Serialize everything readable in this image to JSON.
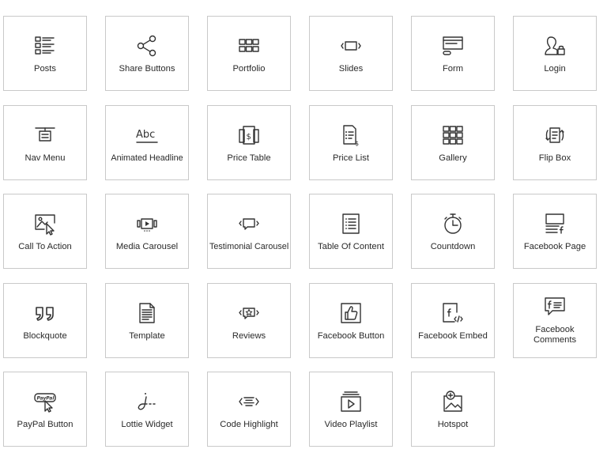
{
  "widgets": [
    {
      "label": "Posts",
      "icon": "posts-icon"
    },
    {
      "label": "Share Buttons",
      "icon": "share-icon"
    },
    {
      "label": "Portfolio",
      "icon": "portfolio-icon"
    },
    {
      "label": "Slides",
      "icon": "slides-icon"
    },
    {
      "label": "Form",
      "icon": "form-icon"
    },
    {
      "label": "Login",
      "icon": "login-icon"
    },
    {
      "label": "Nav Menu",
      "icon": "nav-menu-icon"
    },
    {
      "label": "Animated Headline",
      "icon": "animated-headline-icon",
      "icon_text": "Abc"
    },
    {
      "label": "Price Table",
      "icon": "price-table-icon"
    },
    {
      "label": "Price List",
      "icon": "price-list-icon"
    },
    {
      "label": "Gallery",
      "icon": "gallery-icon"
    },
    {
      "label": "Flip Box",
      "icon": "flip-box-icon"
    },
    {
      "label": "Call To Action",
      "icon": "call-to-action-icon"
    },
    {
      "label": "Media Carousel",
      "icon": "media-carousel-icon"
    },
    {
      "label": "Testimonial Carousel",
      "icon": "testimonial-carousel-icon"
    },
    {
      "label": "Table Of Content",
      "icon": "table-of-content-icon"
    },
    {
      "label": "Countdown",
      "icon": "countdown-icon"
    },
    {
      "label": "Facebook Page",
      "icon": "facebook-page-icon"
    },
    {
      "label": "Blockquote",
      "icon": "blockquote-icon"
    },
    {
      "label": "Template",
      "icon": "template-icon"
    },
    {
      "label": "Reviews",
      "icon": "reviews-icon"
    },
    {
      "label": "Facebook Button",
      "icon": "facebook-button-icon"
    },
    {
      "label": "Facebook Embed",
      "icon": "facebook-embed-icon"
    },
    {
      "label": "Facebook Comments",
      "icon": "facebook-comments-icon"
    },
    {
      "label": "PayPal Button",
      "icon": "paypal-button-icon",
      "icon_text": "PayPal"
    },
    {
      "label": "Lottie Widget",
      "icon": "lottie-widget-icon"
    },
    {
      "label": "Code Highlight",
      "icon": "code-highlight-icon"
    },
    {
      "label": "Video Playlist",
      "icon": "video-playlist-icon"
    },
    {
      "label": "Hotspot",
      "icon": "hotspot-icon"
    }
  ]
}
